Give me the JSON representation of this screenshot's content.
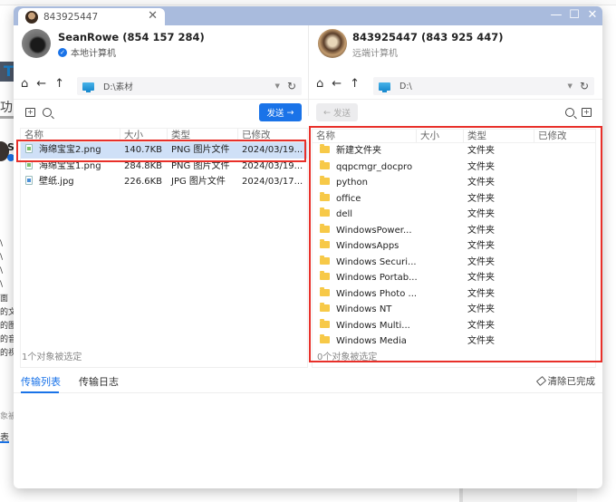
{
  "background": {
    "logo_char": "T",
    "func_text": "功",
    "side_texts": [
      "\\",
      "\\",
      "\\",
      "\\",
      "面",
      "的文",
      "的图",
      "的音",
      "的视"
    ],
    "status_fragment": "象被",
    "tab_fragment": "表"
  },
  "window": {
    "tab_title": "843925447",
    "tab_close": "✕",
    "controls": {
      "minimize": "—",
      "maximize": "☐",
      "close": "✕"
    }
  },
  "local": {
    "user_name": "SeanRowe (854 157 284)",
    "user_label": "本地计算机",
    "path": "D:\\素材",
    "send_label": "发送",
    "columns": [
      "名称",
      "大小",
      "类型",
      "已修改"
    ],
    "files": [
      {
        "name": "海绵宝宝2.png",
        "size": "140.7KB",
        "type": "PNG 图片文件",
        "modified": "2024/03/19...",
        "icon": "png",
        "selected": true
      },
      {
        "name": "海绵宝宝1.png",
        "size": "284.8KB",
        "type": "PNG 图片文件",
        "modified": "2024/03/19...",
        "icon": "png",
        "selected": false
      },
      {
        "name": "壁纸.jpg",
        "size": "226.6KB",
        "type": "JPG 图片文件",
        "modified": "2024/03/17...",
        "icon": "jpg",
        "selected": false
      }
    ],
    "status": "1个对象被选定"
  },
  "remote": {
    "user_name": "843925447 (843 925 447)",
    "user_label": "远端计算机",
    "path": "D:\\",
    "send_label": "发送",
    "columns": [
      "名称",
      "大小",
      "类型",
      "已修改"
    ],
    "files": [
      {
        "name": "新建文件夹",
        "type": "文件夹"
      },
      {
        "name": "qqpcmgr_docpro",
        "type": "文件夹"
      },
      {
        "name": "python",
        "type": "文件夹"
      },
      {
        "name": "office",
        "type": "文件夹"
      },
      {
        "name": "dell",
        "type": "文件夹"
      },
      {
        "name": "WindowsPower...",
        "type": "文件夹"
      },
      {
        "name": "WindowsApps",
        "type": "文件夹"
      },
      {
        "name": "Windows Securi...",
        "type": "文件夹"
      },
      {
        "name": "Windows Portab...",
        "type": "文件夹"
      },
      {
        "name": "Windows Photo ...",
        "type": "文件夹"
      },
      {
        "name": "Windows NT",
        "type": "文件夹"
      },
      {
        "name": "Windows Multi...",
        "type": "文件夹"
      },
      {
        "name": "Windows Media",
        "type": "文件夹"
      }
    ],
    "status": "0个对象被选定"
  },
  "transfer": {
    "tabs": [
      "传输列表",
      "传输日志"
    ],
    "active_tab": 0,
    "clear_label": "清除已完成"
  },
  "highlight_color": "#e8302a",
  "accent_color": "#1a73e8"
}
